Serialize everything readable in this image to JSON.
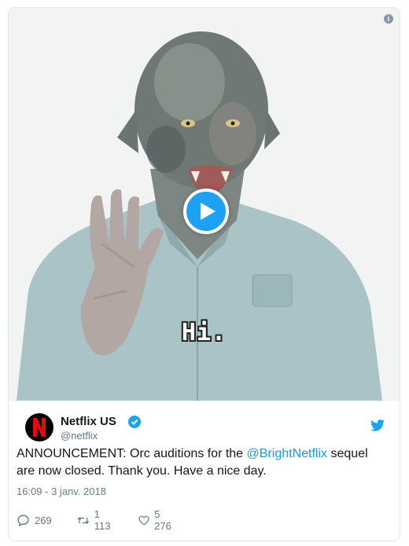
{
  "media": {
    "caption": "Hi.",
    "info_icon": "info-icon",
    "play_icon": "play-icon"
  },
  "author": {
    "name": "Netflix US",
    "handle": "@netflix",
    "avatar_letter": "N",
    "verified_icon": "verified-badge-icon"
  },
  "tweet": {
    "text_before": "ANNOUNCEMENT: Orc auditions for the ",
    "mention": "@BrightNetflix",
    "text_after": " sequel are now closed. Thank you. Have a nice day.",
    "timestamp": "16:09 - 3 janv. 2018"
  },
  "actions": {
    "replies": "269",
    "retweets": "1 113",
    "likes": "5 276"
  },
  "colors": {
    "accent": "#1da1f2",
    "mention": "#1b95e0",
    "netflix_red": "#e50914",
    "muted": "#657786"
  }
}
